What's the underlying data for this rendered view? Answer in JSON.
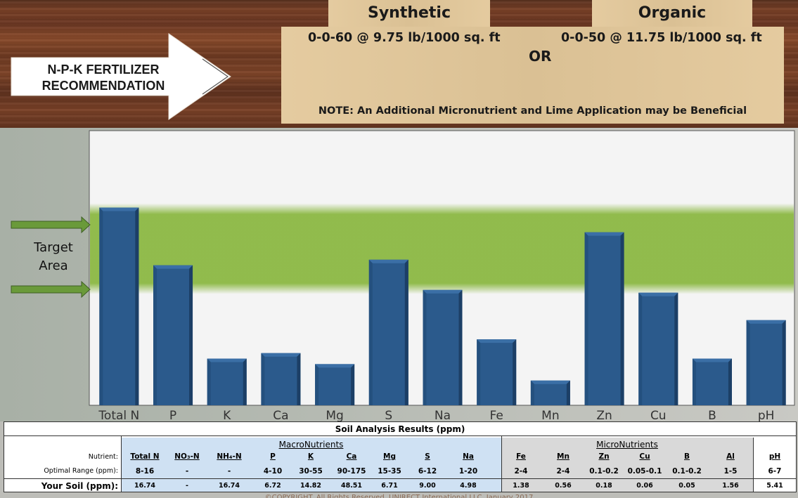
{
  "header": {
    "arrow_label_line1": "N-P-K  FERTILIZER",
    "arrow_label_line2": "RECOMMENDATION",
    "synthetic_title": "Synthetic",
    "organic_title": "Organic",
    "synthetic_rate": "0-0-60 @ 9.75 lb/1000 sq. ft",
    "organic_rate": "0-0-50 @ 11.75 lb/1000 sq. ft",
    "or_label": "OR",
    "note": "NOTE: An Additional Micronutrient and Lime Application may be Beneficial"
  },
  "target_area": {
    "line1": "Target",
    "line2": "Area"
  },
  "colors": {
    "bar": "#2b5a8c",
    "bar_dark": "#1c3f66",
    "target_band": "#86b53a",
    "arrow_green": "#6a9a3a"
  },
  "chart_data": {
    "type": "bar",
    "categories": [
      "Total N",
      "P",
      "K",
      "Ca",
      "Mg",
      "S",
      "Na",
      "Fe",
      "Mn",
      "Zn",
      "Cu",
      "B",
      "pH"
    ],
    "values": [
      0.72,
      0.51,
      0.17,
      0.19,
      0.15,
      0.53,
      0.42,
      0.24,
      0.09,
      0.63,
      0.41,
      0.17,
      0.31
    ],
    "value_scale": "relative bar height within plot (0-1); target band spans 0.42-0.72",
    "target_band": [
      0.42,
      0.72
    ],
    "ylim": [
      0,
      1
    ],
    "grid": false
  },
  "table": {
    "title": "Soil Analysis Results (ppm)",
    "macro_label": "MacroNutrients",
    "micro_label": "MicroNutrients",
    "row_labels": [
      "Nutrient:",
      "Optimal Range (ppm):",
      "Your Soil (ppm):"
    ],
    "nutrients": [
      "Total N",
      "NO₃-N",
      "NH₄-N",
      "P",
      "K",
      "Ca",
      "Mg",
      "S",
      "Na",
      "Fe",
      "Mn",
      "Zn",
      "Cu",
      "B",
      "Al",
      "pH"
    ],
    "optimal": [
      "8-16",
      "-",
      "-",
      "4-10",
      "30-55",
      "90-175",
      "15-35",
      "6-12",
      "1-20",
      "2-4",
      "2-4",
      "0.1-0.2",
      "0.05-0.1",
      "0.1-0.2",
      "1-5",
      "6-7"
    ],
    "your_soil": [
      "16.74",
      "-",
      "16.74",
      "6.72",
      "14.82",
      "48.51",
      "6.71",
      "9.00",
      "4.98",
      "1.38",
      "0.56",
      "0.18",
      "0.06",
      "0.05",
      "1.56",
      "5.41"
    ]
  },
  "footer": {
    "copyright": "©COPYRIGHT. All Rights Reserved. UNIRECT International LLC. January 2017"
  }
}
